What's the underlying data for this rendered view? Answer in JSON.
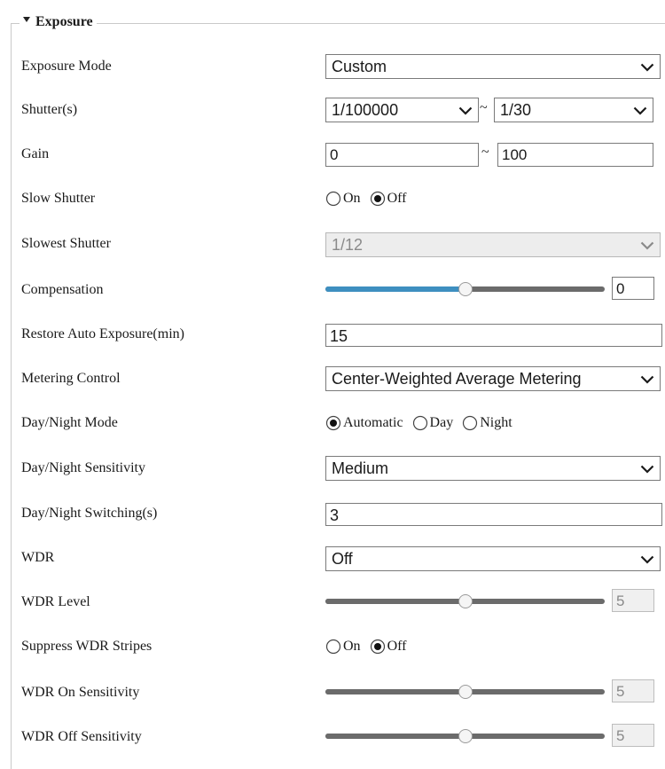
{
  "section": {
    "title": "Exposure"
  },
  "exposure_mode": {
    "label": "Exposure Mode",
    "value": "Custom"
  },
  "shutter": {
    "label": "Shutter(s)",
    "min": "1/100000",
    "separator": "~",
    "max": "1/30"
  },
  "gain": {
    "label": "Gain",
    "min": "0",
    "separator": "~",
    "max": "100"
  },
  "slow_shutter": {
    "label": "Slow Shutter",
    "options": [
      "On",
      "Off"
    ],
    "selected": "Off"
  },
  "slowest_shutter": {
    "label": "Slowest Shutter",
    "value": "1/12",
    "disabled": true
  },
  "compensation": {
    "label": "Compensation",
    "value": "0",
    "level": 0.5
  },
  "restore_auto_exposure": {
    "label": "Restore Auto Exposure(min)",
    "value": "15"
  },
  "metering_control": {
    "label": "Metering Control",
    "value": "Center-Weighted Average Metering"
  },
  "day_night_mode": {
    "label": "Day/Night Mode",
    "options": [
      "Automatic",
      "Day",
      "Night"
    ],
    "selected": "Automatic"
  },
  "day_night_sensitivity": {
    "label": "Day/Night Sensitivity",
    "value": "Medium"
  },
  "day_night_switching": {
    "label": "Day/Night Switching(s)",
    "value": "3"
  },
  "wdr": {
    "label": "WDR",
    "value": "Off"
  },
  "wdr_level": {
    "label": "WDR Level",
    "value": "5",
    "level": 0.5
  },
  "suppress_wdr_stripes": {
    "label": "Suppress WDR Stripes",
    "options": [
      "On",
      "Off"
    ],
    "selected": "Off"
  },
  "wdr_on_sensitivity": {
    "label": "WDR On Sensitivity",
    "value": "5",
    "level": 0.5
  },
  "wdr_off_sensitivity": {
    "label": "WDR Off Sensitivity",
    "value": "5",
    "level": 0.5
  },
  "colors": {
    "slider_fill": "#3e8fc0",
    "slider_track": "#6b6b6b"
  }
}
